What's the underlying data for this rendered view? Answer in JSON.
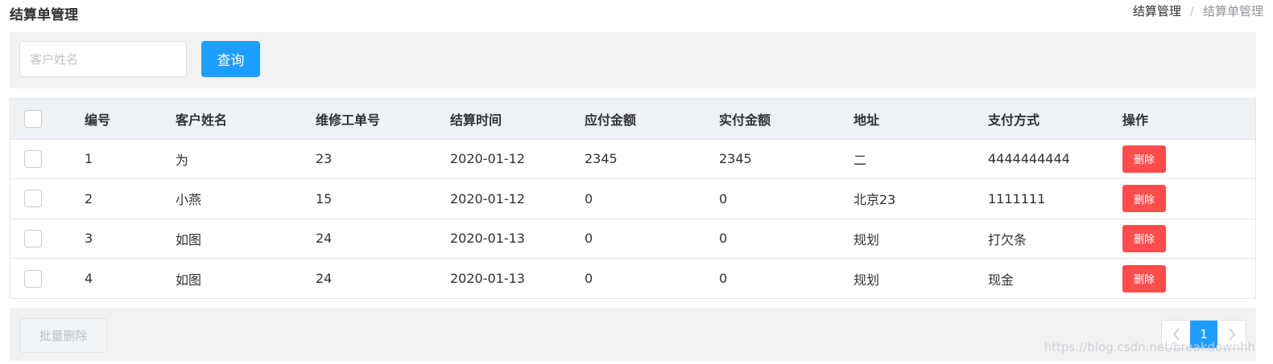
{
  "header": {
    "title": "结算单管理",
    "breadcrumb": [
      "结算管理",
      "结算单管理"
    ],
    "breadcrumb_separator": "/"
  },
  "search": {
    "placeholder": "客户姓名",
    "value": "",
    "query_label": "查询"
  },
  "table": {
    "columns": [
      "编号",
      "客户姓名",
      "维修工单号",
      "结算时间",
      "应付金额",
      "实付金额",
      "地址",
      "支付方式",
      "操作"
    ],
    "rows": [
      {
        "id": "1",
        "customer": "为",
        "order_no": "23",
        "time": "2020-01-12",
        "payable": "2345",
        "paid": "2345",
        "address": "二",
        "payment": "4444444444",
        "action": "删除"
      },
      {
        "id": "2",
        "customer": "小燕",
        "order_no": "15",
        "time": "2020-01-12",
        "payable": "0",
        "paid": "0",
        "address": "北京23",
        "payment": "1111111",
        "action": "删除"
      },
      {
        "id": "3",
        "customer": "如图",
        "order_no": "24",
        "time": "2020-01-13",
        "payable": "0",
        "paid": "0",
        "address": "规划",
        "payment": "打欠条",
        "action": "删除"
      },
      {
        "id": "4",
        "customer": "如图",
        "order_no": "24",
        "time": "2020-01-13",
        "payable": "0",
        "paid": "0",
        "address": "规划",
        "payment": "现金",
        "action": "删除"
      }
    ]
  },
  "footer": {
    "batch_delete_label": "批量删除",
    "pagination": {
      "prev_icon": "chevron-left-icon",
      "current_page": "1",
      "next_icon": "chevron-right-icon"
    },
    "watermark": "https://blog.csdn.net/breakdownhh"
  },
  "colors": {
    "primary": "#1e9fff",
    "danger": "#ff4c4c",
    "panel_bg": "#f2f2f2",
    "table_header_bg": "#eef1f6"
  }
}
